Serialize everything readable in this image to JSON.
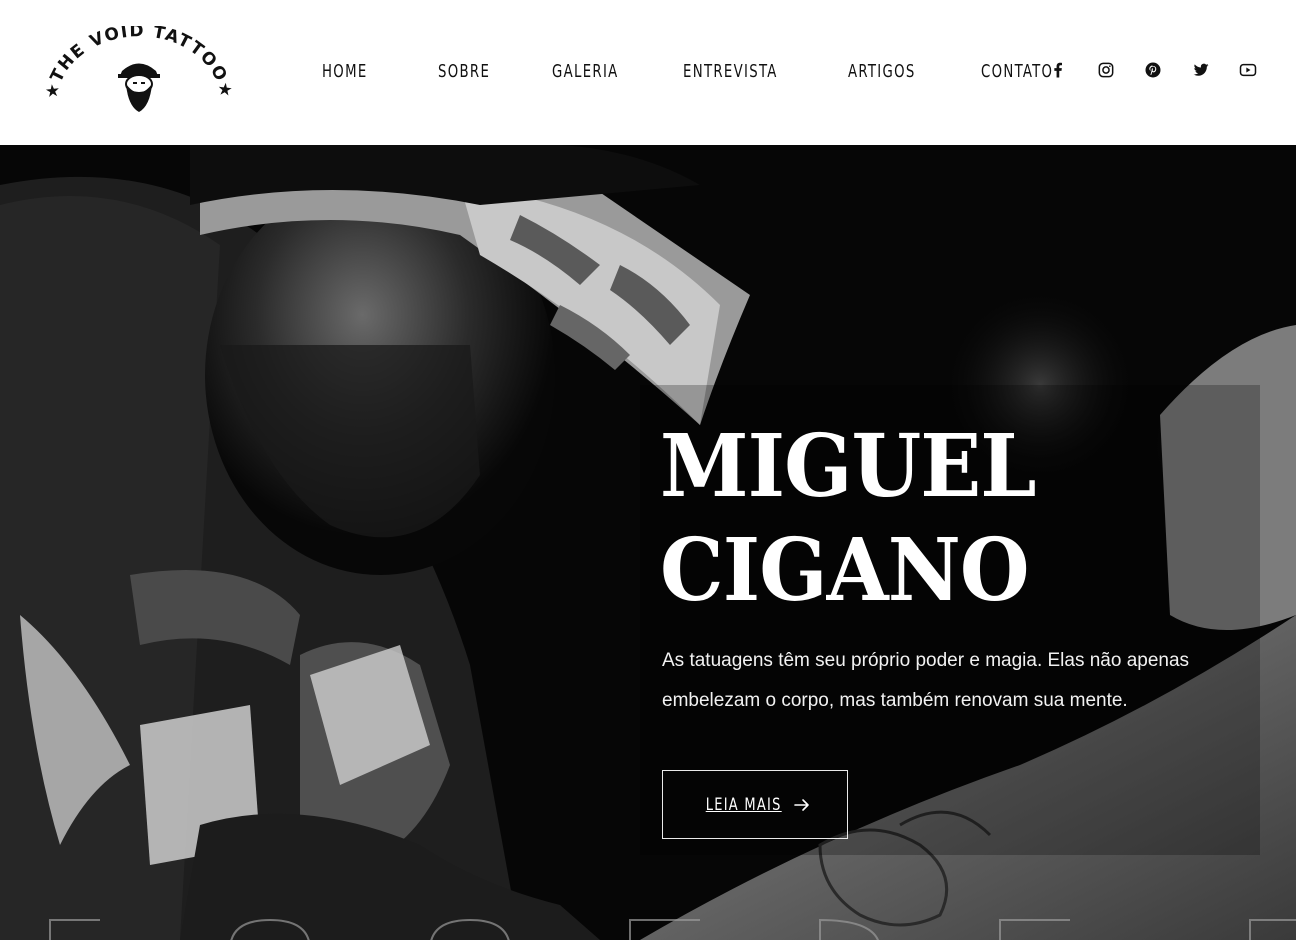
{
  "brand": {
    "logo_text": "THE VOID TATTOO",
    "logo_icon": "bearded-man-cap-icon"
  },
  "nav": {
    "items": [
      {
        "label": "HOME"
      },
      {
        "label": "SOBRE"
      },
      {
        "label": "GALERIA"
      },
      {
        "label": "ENTREVISTA"
      },
      {
        "label": "ARTIGOS"
      },
      {
        "label": "CONTATO"
      }
    ]
  },
  "social": {
    "icons": [
      "facebook-icon",
      "instagram-icon",
      "pinterest-icon",
      "twitter-icon",
      "youtube-icon"
    ]
  },
  "hero": {
    "title_line1": "MIGUEL",
    "title_line2": "CIGANO",
    "text": "As tatuagens têm seu próprio poder e magia. Elas não apenas embelezam o corpo, mas também renovam sua mente.",
    "button_label": "LEIA MAIS",
    "button_icon": "arrow-right-icon"
  },
  "colors": {
    "header_bg": "#ffffff",
    "hero_bg": "#050505",
    "text_dark": "#111111",
    "text_light": "#ffffff"
  }
}
